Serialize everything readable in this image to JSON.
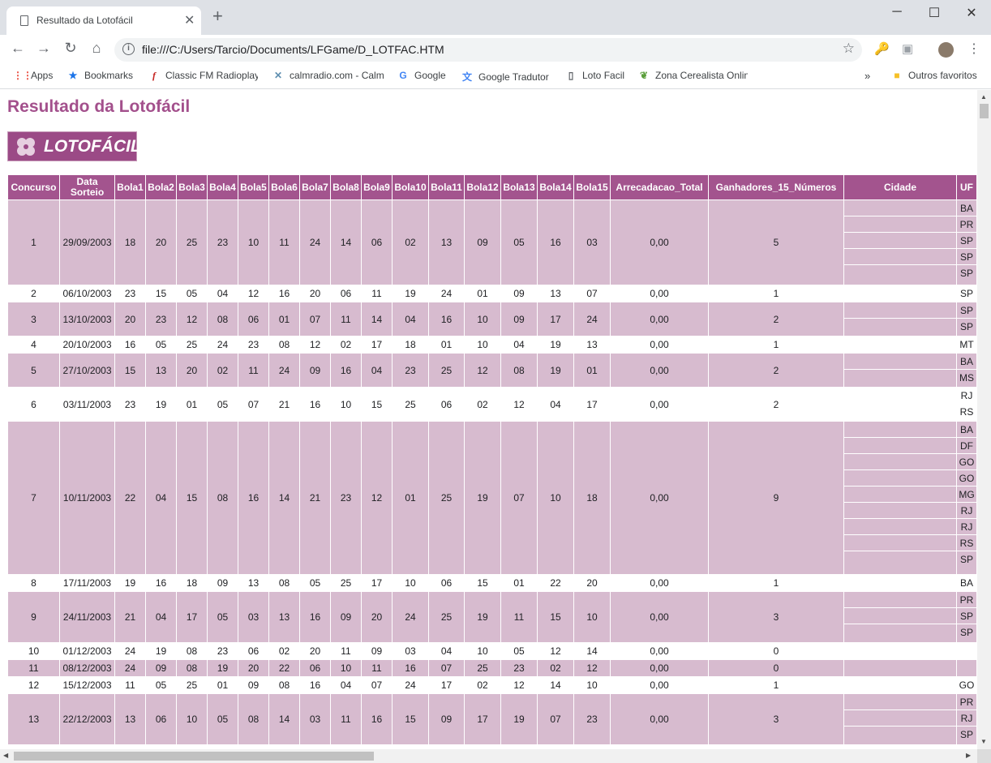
{
  "browser": {
    "tab_title": "Resultado da Lotofácil",
    "url": "file:///C:/Users/Tarcio/Documents/LFGame/D_LOTFAC.HTM",
    "bookmarks": [
      {
        "icon": "apps-grid-icon",
        "label": "Apps"
      },
      {
        "icon": "star-icon",
        "label": "Bookmarks"
      },
      {
        "icon": "f-logo-icon",
        "label": "Classic FM Radioplayer"
      },
      {
        "icon": "calmradio-icon",
        "label": "calmradio.com - Calm"
      },
      {
        "icon": "google-icon",
        "label": "Google"
      },
      {
        "icon": "google-translate-icon",
        "label": "Google Tradutor"
      },
      {
        "icon": "page-icon",
        "label": "Loto Facil"
      },
      {
        "icon": "leaf-icon",
        "label": "Zona Cerealista Online"
      }
    ],
    "overflow": "»",
    "other_bookmarks": "Outros favoritos"
  },
  "page": {
    "title": "Resultado da Lotofácil",
    "logo_text": "LOTOFÁCIL"
  },
  "table": {
    "headers": [
      "Concurso",
      "Data Sorteio",
      "Bola1",
      "Bola2",
      "Bola3",
      "Bola4",
      "Bola5",
      "Bola6",
      "Bola7",
      "Bola8",
      "Bola9",
      "Bola10",
      "Bola11",
      "Bola12",
      "Bola13",
      "Bola14",
      "Bola15",
      "Arrecadacao_Total",
      "Ganhadores_15_Números",
      "Cidade",
      "UF"
    ],
    "rows": [
      {
        "concurso": "1",
        "data": "29/09/2003",
        "bolas": [
          "18",
          "20",
          "25",
          "23",
          "10",
          "11",
          "24",
          "14",
          "06",
          "02",
          "13",
          "09",
          "05",
          "16",
          "03"
        ],
        "arrecadacao": "0,00",
        "ganhadores": "5",
        "cidades": [
          "",
          "",
          "",
          "",
          ""
        ],
        "ufs": [
          "BA",
          "PR",
          "SP",
          "SP",
          "SP"
        ]
      },
      {
        "concurso": "2",
        "data": "06/10/2003",
        "bolas": [
          "23",
          "15",
          "05",
          "04",
          "12",
          "16",
          "20",
          "06",
          "11",
          "19",
          "24",
          "01",
          "09",
          "13",
          "07"
        ],
        "arrecadacao": "0,00",
        "ganhadores": "1",
        "cidades": [
          ""
        ],
        "ufs": [
          "SP"
        ]
      },
      {
        "concurso": "3",
        "data": "13/10/2003",
        "bolas": [
          "20",
          "23",
          "12",
          "08",
          "06",
          "01",
          "07",
          "11",
          "14",
          "04",
          "16",
          "10",
          "09",
          "17",
          "24"
        ],
        "arrecadacao": "0,00",
        "ganhadores": "2",
        "cidades": [
          "",
          ""
        ],
        "ufs": [
          "SP",
          "SP"
        ]
      },
      {
        "concurso": "4",
        "data": "20/10/2003",
        "bolas": [
          "16",
          "05",
          "25",
          "24",
          "23",
          "08",
          "12",
          "02",
          "17",
          "18",
          "01",
          "10",
          "04",
          "19",
          "13"
        ],
        "arrecadacao": "0,00",
        "ganhadores": "1",
        "cidades": [
          ""
        ],
        "ufs": [
          "MT"
        ]
      },
      {
        "concurso": "5",
        "data": "27/10/2003",
        "bolas": [
          "15",
          "13",
          "20",
          "02",
          "11",
          "24",
          "09",
          "16",
          "04",
          "23",
          "25",
          "12",
          "08",
          "19",
          "01"
        ],
        "arrecadacao": "0,00",
        "ganhadores": "2",
        "cidades": [
          "",
          ""
        ],
        "ufs": [
          "BA",
          "MS"
        ]
      },
      {
        "concurso": "6",
        "data": "03/11/2003",
        "bolas": [
          "23",
          "19",
          "01",
          "05",
          "07",
          "21",
          "16",
          "10",
          "15",
          "25",
          "06",
          "02",
          "12",
          "04",
          "17"
        ],
        "arrecadacao": "0,00",
        "ganhadores": "2",
        "cidades": [
          "",
          ""
        ],
        "ufs": [
          "RJ",
          "RS"
        ]
      },
      {
        "concurso": "7",
        "data": "10/11/2003",
        "bolas": [
          "22",
          "04",
          "15",
          "08",
          "16",
          "14",
          "21",
          "23",
          "12",
          "01",
          "25",
          "19",
          "07",
          "10",
          "18"
        ],
        "arrecadacao": "0,00",
        "ganhadores": "9",
        "cidades": [
          "",
          "",
          "",
          "",
          "",
          "",
          "",
          "",
          ""
        ],
        "ufs": [
          "BA",
          "DF",
          "GO",
          "GO",
          "MG",
          "RJ",
          "RJ",
          "RS",
          "SP"
        ]
      },
      {
        "concurso": "8",
        "data": "17/11/2003",
        "bolas": [
          "19",
          "16",
          "18",
          "09",
          "13",
          "08",
          "05",
          "25",
          "17",
          "10",
          "06",
          "15",
          "01",
          "22",
          "20"
        ],
        "arrecadacao": "0,00",
        "ganhadores": "1",
        "cidades": [
          ""
        ],
        "ufs": [
          "BA"
        ]
      },
      {
        "concurso": "9",
        "data": "24/11/2003",
        "bolas": [
          "21",
          "04",
          "17",
          "05",
          "03",
          "13",
          "16",
          "09",
          "20",
          "24",
          "25",
          "19",
          "11",
          "15",
          "10"
        ],
        "arrecadacao": "0,00",
        "ganhadores": "3",
        "cidades": [
          "",
          "",
          ""
        ],
        "ufs": [
          "PR",
          "SP",
          "SP"
        ]
      },
      {
        "concurso": "10",
        "data": "01/12/2003",
        "bolas": [
          "24",
          "19",
          "08",
          "23",
          "06",
          "02",
          "20",
          "11",
          "09",
          "03",
          "04",
          "10",
          "05",
          "12",
          "14"
        ],
        "arrecadacao": "0,00",
        "ganhadores": "0",
        "cidades": [
          ""
        ],
        "ufs": [
          ""
        ]
      },
      {
        "concurso": "11",
        "data": "08/12/2003",
        "bolas": [
          "24",
          "09",
          "08",
          "19",
          "20",
          "22",
          "06",
          "10",
          "11",
          "16",
          "07",
          "25",
          "23",
          "02",
          "12"
        ],
        "arrecadacao": "0,00",
        "ganhadores": "0",
        "cidades": [
          ""
        ],
        "ufs": [
          ""
        ]
      },
      {
        "concurso": "12",
        "data": "15/12/2003",
        "bolas": [
          "11",
          "05",
          "25",
          "01",
          "09",
          "08",
          "16",
          "04",
          "07",
          "24",
          "17",
          "02",
          "12",
          "14",
          "10"
        ],
        "arrecadacao": "0,00",
        "ganhadores": "1",
        "cidades": [
          ""
        ],
        "ufs": [
          "GO"
        ]
      },
      {
        "concurso": "13",
        "data": "22/12/2003",
        "bolas": [
          "13",
          "06",
          "10",
          "05",
          "08",
          "14",
          "03",
          "11",
          "16",
          "15",
          "09",
          "17",
          "19",
          "07",
          "23"
        ],
        "arrecadacao": "0,00",
        "ganhadores": "3",
        "cidades": [
          "",
          "",
          ""
        ],
        "ufs": [
          "PR",
          "RJ",
          "SP"
        ]
      }
    ]
  }
}
